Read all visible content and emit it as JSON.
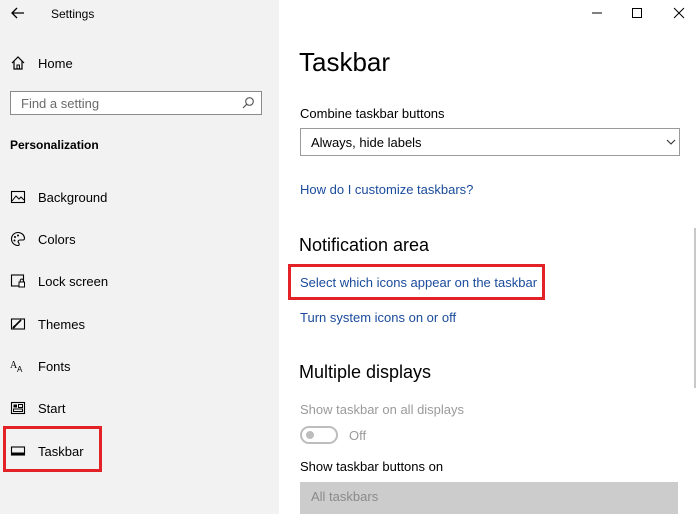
{
  "window": {
    "title": "Settings",
    "controls": {
      "minimize": "minimize-icon",
      "maximize": "maximize-icon",
      "close": "close-icon"
    }
  },
  "sidebar": {
    "home_label": "Home",
    "search_placeholder": "Find a setting",
    "section": "Personalization",
    "items": [
      {
        "label": "Background",
        "icon": "picture-icon"
      },
      {
        "label": "Colors",
        "icon": "palette-icon"
      },
      {
        "label": "Lock screen",
        "icon": "lock-screen-icon"
      },
      {
        "label": "Themes",
        "icon": "themes-icon"
      },
      {
        "label": "Fonts",
        "icon": "fonts-icon"
      },
      {
        "label": "Start",
        "icon": "start-icon"
      },
      {
        "label": "Taskbar",
        "icon": "taskbar-icon",
        "selected": true
      }
    ]
  },
  "main": {
    "title": "Taskbar",
    "combine_label": "Combine taskbar buttons",
    "combine_value": "Always, hide labels",
    "customize_link": "How do I customize taskbars?",
    "notification_heading": "Notification area",
    "select_icons_link": "Select which icons appear on the taskbar",
    "system_icons_link": "Turn system icons on or off",
    "multiple_heading": "Multiple displays",
    "show_all_label": "Show taskbar on all displays",
    "show_all_state": "Off",
    "buttons_on_label": "Show taskbar buttons on",
    "buttons_on_value": "All taskbars"
  },
  "colors": {
    "highlight": "#e32227",
    "link": "#1a4b9c",
    "sidebar_bg": "#f2f2f2"
  }
}
